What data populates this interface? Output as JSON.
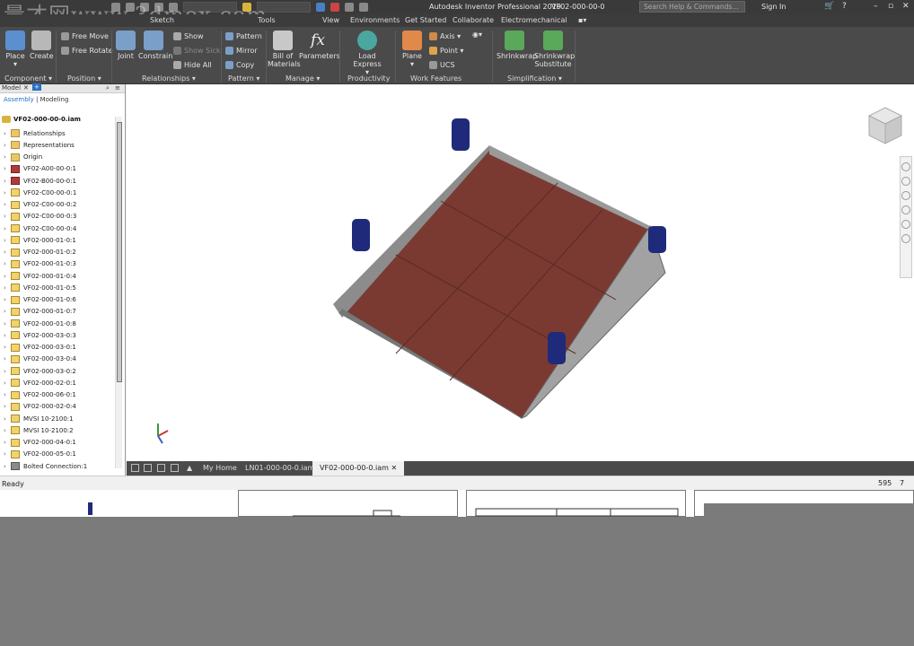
{
  "window": {
    "title": "Autodesk Inventor Professional 2019",
    "document": "VF02-000-00-0",
    "search_placeholder": "Search Help & Commands...",
    "sign_in": "Sign In"
  },
  "watermark": "量才网www.3dmox.com",
  "ribbon_tabs": [
    "Sketch",
    "Tools",
    "View",
    "Environments",
    "Get Started",
    "Collaborate",
    "Electromechanical"
  ],
  "ribbon": {
    "place": "Place",
    "create": "Create",
    "free_move": "Free Move",
    "free_rotate": "Free Rotate",
    "joint": "Joint",
    "constrain": "Constrain",
    "show": "Show",
    "show_sick": "Show Sick",
    "hide_all": "Hide All",
    "pattern": "Pattern",
    "mirror": "Mirror",
    "copy": "Copy",
    "bill_of_materials_1": "Bill of",
    "bill_of_materials_2": "Materials",
    "parameters": "Parameters",
    "load_express": "Load Express",
    "plane": "Plane",
    "axis": "Axis",
    "point": "Point",
    "ucs": "UCS",
    "shrinkwrap": "Shrinkwrap",
    "shrinkwrap_sub_1": "Shrinkwrap",
    "shrinkwrap_sub_2": "Substitute",
    "panels": {
      "component": "Component",
      "position": "Position",
      "relationships": "Relationships",
      "pattern": "Pattern",
      "manage": "Manage",
      "productivity": "Productivity",
      "work_features": "Work Features",
      "simplification": "Simplification"
    }
  },
  "browser": {
    "header": "Model",
    "subtab_assembly": "Assembly",
    "subtab_modeling": "Modeling",
    "root": "VF02-000-00-0.iam",
    "items": [
      {
        "label": "Relationships",
        "icon": "folder"
      },
      {
        "label": "Representations",
        "icon": "folder"
      },
      {
        "label": "Origin",
        "icon": "folder"
      },
      {
        "label": "VF02-A00-00-0:1",
        "icon": "red"
      },
      {
        "label": "VF02-B00-00-0:1",
        "icon": "red"
      },
      {
        "label": "VF02-C00-00-0:1",
        "icon": "part"
      },
      {
        "label": "VF02-C00-00-0:2",
        "icon": "part"
      },
      {
        "label": "VF02-C00-00-0:3",
        "icon": "part"
      },
      {
        "label": "VF02-C00-00-0:4",
        "icon": "part"
      },
      {
        "label": "VF02-000-01-0:1",
        "icon": "part"
      },
      {
        "label": "VF02-000-01-0:2",
        "icon": "part"
      },
      {
        "label": "VF02-000-01-0:3",
        "icon": "part"
      },
      {
        "label": "VF02-000-01-0:4",
        "icon": "part"
      },
      {
        "label": "VF02-000-01-0:5",
        "icon": "part"
      },
      {
        "label": "VF02-000-01-0:6",
        "icon": "part"
      },
      {
        "label": "VF02-000-01-0:7",
        "icon": "part"
      },
      {
        "label": "VF02-000-01-0:8",
        "icon": "part"
      },
      {
        "label": "VF02-000-03-0:3",
        "icon": "part"
      },
      {
        "label": "VF02-000-03-0:1",
        "icon": "part"
      },
      {
        "label": "VF02-000-03-0:4",
        "icon": "part"
      },
      {
        "label": "VF02-000-03-0:2",
        "icon": "part"
      },
      {
        "label": "VF02-000-02-0:1",
        "icon": "part"
      },
      {
        "label": "VF02-000-06-0:1",
        "icon": "part"
      },
      {
        "label": "VF02-000-02-0:4",
        "icon": "part"
      },
      {
        "label": "MVSI 10-2100:1",
        "icon": "part"
      },
      {
        "label": "MVSI 10-2100:2",
        "icon": "part"
      },
      {
        "label": "VF02-000-04-0:1",
        "icon": "part"
      },
      {
        "label": "VF02-000-05-0:1",
        "icon": "part"
      },
      {
        "label": "Bolted Connection:1",
        "icon": "bolt"
      }
    ]
  },
  "doc_tabs": [
    "My Home",
    "LN01-000-00-0.iam",
    "VF02-000-00-0.iam"
  ],
  "status": {
    "ready": "Ready",
    "count1": "595",
    "count2": "7"
  },
  "colors": {
    "plate": "#7a3a32",
    "frame": "#8c8c8c",
    "mount": "#1f2a7a"
  }
}
